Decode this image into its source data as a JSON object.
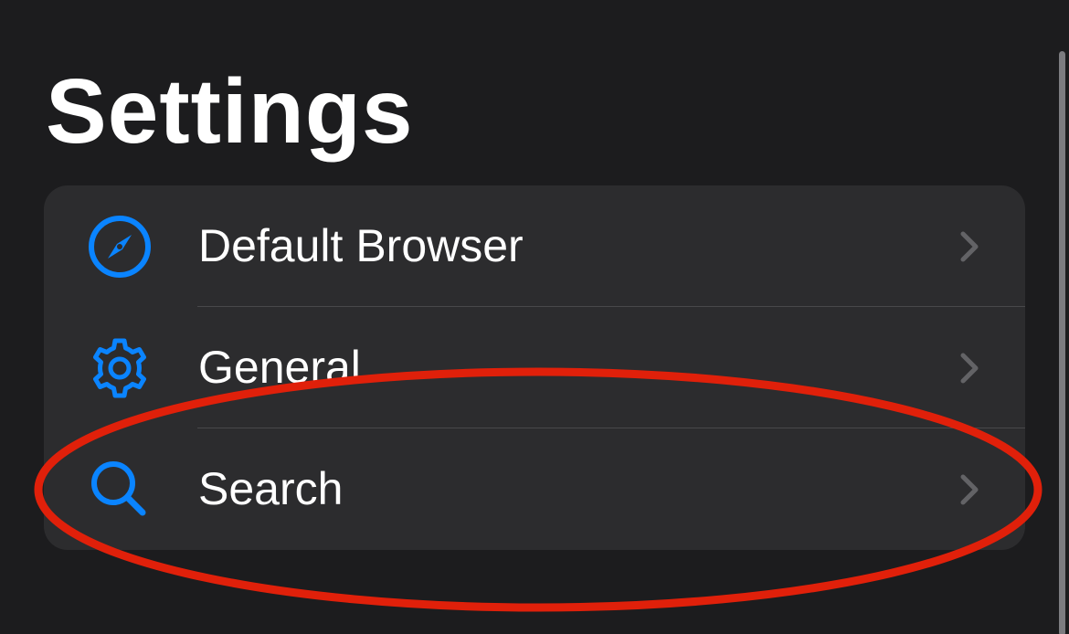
{
  "header": {
    "title": "Settings"
  },
  "settings": {
    "items": [
      {
        "label": "Default Browser",
        "icon": "compass-icon"
      },
      {
        "label": "General",
        "icon": "gear-icon"
      },
      {
        "label": "Search",
        "icon": "search-icon"
      }
    ]
  },
  "colors": {
    "background": "#1c1c1e",
    "group_background": "#2c2c2e",
    "accent": "#0a84ff",
    "chevron": "#636366",
    "annotation": "#e0200a"
  }
}
